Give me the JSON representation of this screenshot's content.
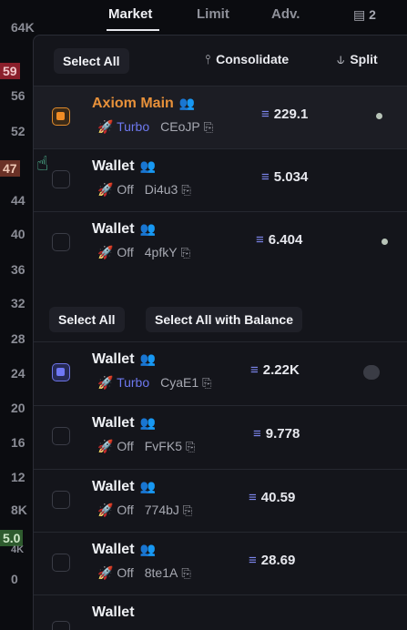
{
  "axis": {
    "labels": [
      "64K",
      "59",
      "56",
      "52",
      "47",
      "44",
      "40",
      "36",
      "32",
      "28",
      "24",
      "20",
      "16",
      "12",
      "8K",
      "5.0",
      "4K",
      "0"
    ],
    "label_64k": "64K",
    "l59": "59",
    "l56": "56",
    "l52": "52",
    "l47": "47",
    "l44": "44",
    "l40": "40",
    "l36": "36",
    "l32": "32",
    "l28": "28",
    "l24": "24",
    "l20": "20",
    "l16": "16",
    "l12": "12",
    "l8k": "8K",
    "l50": "5.0",
    "l4k": "4K",
    "l0": "0"
  },
  "tabs": {
    "market": "Market",
    "limit": "Limit",
    "adv": "Adv.",
    "count": "2"
  },
  "header": {
    "select_all": "Select All",
    "consolidate": "Consolidate",
    "split": "Split"
  },
  "main_wallets": [
    {
      "name": "Axiom Main",
      "mode": "Turbo",
      "id": "CEoJP",
      "balance": "229.1"
    },
    {
      "name": "Wallet",
      "mode": "Off",
      "id": "Di4u3",
      "balance": "5.034"
    },
    {
      "name": "Wallet",
      "mode": "Off",
      "id": "4pfkY",
      "balance": "6.404"
    }
  ],
  "section2": {
    "select_all": "Select All",
    "select_all_balance": "Select All with Balance"
  },
  "other_wallets": [
    {
      "name": "Wallet",
      "mode": "Turbo",
      "id": "CyaE1",
      "balance": "2.22K"
    },
    {
      "name": "Wallet",
      "mode": "Off",
      "id": "FvFK5",
      "balance": "9.778"
    },
    {
      "name": "Wallet",
      "mode": "Off",
      "id": "774bJ",
      "balance": "40.59"
    },
    {
      "name": "Wallet",
      "mode": "Off",
      "id": "8te1A",
      "balance": "28.69"
    },
    {
      "name": "Wallet",
      "mode": "",
      "id": "",
      "balance": ""
    }
  ],
  "icons": {
    "people": "people-icon",
    "turbo": "rocket-icon",
    "copy": "copy-icon",
    "sol": "solana-icon",
    "consolidate": "merge-icon",
    "split": "split-icon"
  },
  "colors": {
    "accent_orange": "#e8913a",
    "accent_blue": "#6f78f5",
    "bg": "#14151b"
  }
}
